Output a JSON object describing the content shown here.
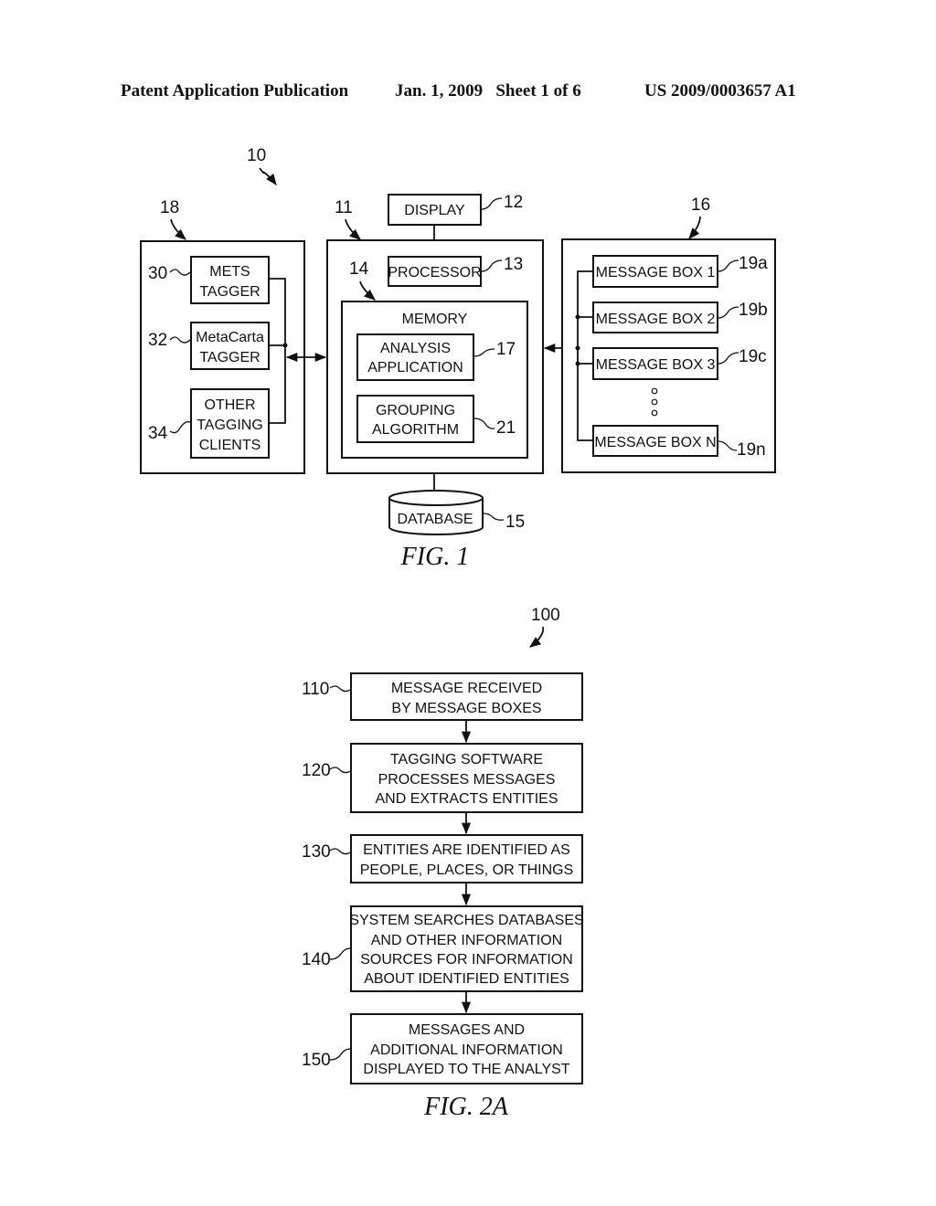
{
  "header": {
    "publication": "Patent Application Publication",
    "date_sheet": "Jan. 1, 2009   Sheet 1 of 6",
    "number": "US 2009/0003657 A1"
  },
  "fig1": {
    "caption": "FIG. 1",
    "system_ref": "10",
    "left_group": {
      "ref": "18",
      "items": [
        {
          "ref": "30",
          "lines": [
            "METS",
            "TAGGER"
          ]
        },
        {
          "ref": "32",
          "lines": [
            "MetaCarta",
            "TAGGER"
          ]
        },
        {
          "ref": "34",
          "lines": [
            "OTHER",
            "TAGGING",
            "CLIENTS"
          ]
        }
      ]
    },
    "center_group": {
      "ref": "11",
      "display": {
        "ref": "12",
        "label": "DISPLAY"
      },
      "processor": {
        "ref": "13",
        "label": "PROCESSOR"
      },
      "memory": {
        "ref": "14",
        "label": "MEMORY",
        "analysis": {
          "ref": "17",
          "lines": [
            "ANALYSIS",
            "APPLICATION"
          ]
        },
        "grouping": {
          "ref": "21",
          "lines": [
            "GROUPING",
            "ALGORITHM"
          ]
        }
      },
      "database": {
        "ref": "15",
        "label": "DATABASE"
      }
    },
    "right_group": {
      "ref": "16",
      "items": [
        {
          "ref": "19a",
          "label": "MESSAGE BOX 1"
        },
        {
          "ref": "19b",
          "label": "MESSAGE BOX 2"
        },
        {
          "ref": "19c",
          "label": "MESSAGE BOX 3"
        },
        {
          "ref": "19n",
          "label": "MESSAGE BOX N"
        }
      ]
    }
  },
  "fig2a": {
    "caption": "FIG. 2A",
    "ref": "100",
    "steps": [
      {
        "ref": "110",
        "lines": [
          "MESSAGE RECEIVED",
          "BY MESSAGE BOXES"
        ]
      },
      {
        "ref": "120",
        "lines": [
          "TAGGING SOFTWARE",
          "PROCESSES MESSAGES",
          "AND EXTRACTS ENTITIES"
        ]
      },
      {
        "ref": "130",
        "lines": [
          "ENTITIES ARE IDENTIFIED AS",
          "PEOPLE, PLACES, OR THINGS"
        ]
      },
      {
        "ref": "140",
        "lines": [
          "SYSTEM SEARCHES DATABASES",
          "AND OTHER INFORMATION",
          "SOURCES FOR INFORMATION",
          "ABOUT IDENTIFIED ENTITIES"
        ]
      },
      {
        "ref": "150",
        "lines": [
          "MESSAGES AND",
          "ADDITIONAL INFORMATION",
          "DISPLAYED TO THE ANALYST"
        ]
      }
    ]
  }
}
